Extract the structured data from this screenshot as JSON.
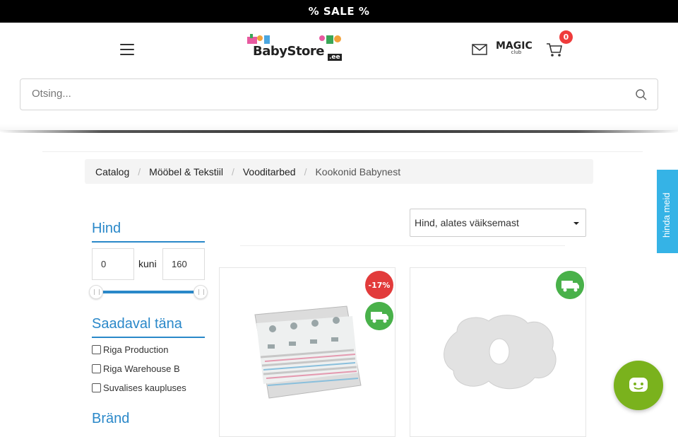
{
  "topbar": {
    "text": "% SALE %"
  },
  "header": {
    "logo_text": "BabyStore",
    "logo_domain": ".ee",
    "magic": {
      "title": "MAGIC",
      "sub": "club"
    },
    "cart_count": "0"
  },
  "search": {
    "placeholder": "Otsing..."
  },
  "breadcrumb": {
    "items": [
      "Catalog",
      "Mööbel & Tekstiil",
      "Vooditarbed"
    ],
    "current": "Kookonid Babynest"
  },
  "sort": {
    "selected": "Hind, alates väiksemast"
  },
  "filters": {
    "price_title": "Hind",
    "price_min": "0",
    "price_sep": "kuni",
    "price_max": "160",
    "availability_title": "Saadaval täna",
    "availability": [
      "Riga Production",
      "Riga Warehouse B",
      "Suvalises kaupluses"
    ],
    "brand_title": "Bränd"
  },
  "products": [
    {
      "discount": "-17%",
      "free_shipping": true
    },
    {
      "discount": "",
      "free_shipping": true
    }
  ],
  "side_tab": {
    "label": "hinda meid"
  },
  "colors": {
    "accent": "#2a88c9",
    "sale": "#e23b3b",
    "shipping": "#49b14a",
    "chat": "#7ab21d",
    "side_tab": "#35b3e6"
  }
}
